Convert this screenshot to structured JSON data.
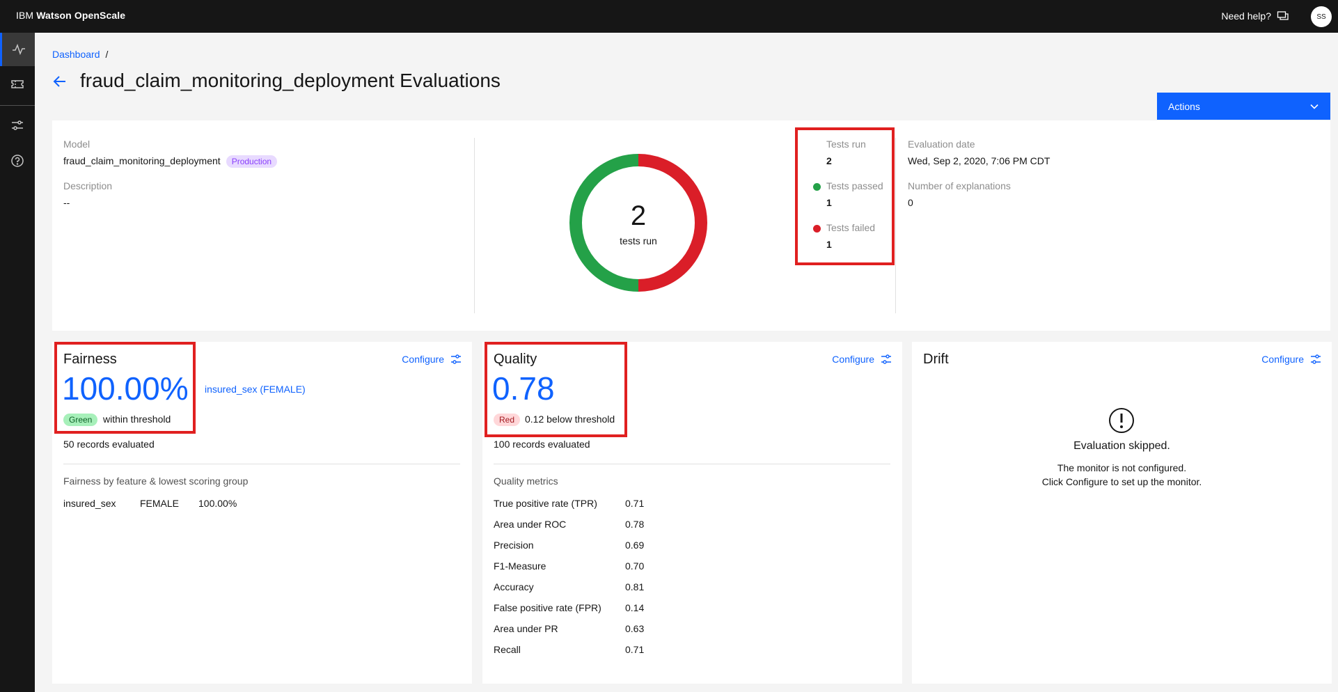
{
  "topbar": {
    "brand_prefix": "IBM",
    "brand_name": "Watson OpenScale",
    "help_label": "Need help?",
    "avatar_initials": "SS"
  },
  "rail": {
    "items": [
      "activity-icon",
      "ticket-icon",
      "sliders-icon",
      "help-icon"
    ]
  },
  "breadcrumb": {
    "root": "Dashboard",
    "separator": "/"
  },
  "page": {
    "title": "fraud_claim_monitoring_deployment Evaluations"
  },
  "actions": {
    "label": "Actions"
  },
  "summary": {
    "model_label": "Model",
    "model_value": "fraud_claim_monitoring_deployment",
    "model_badge": "Production",
    "description_label": "Description",
    "description_value": "--",
    "donut_value": "2",
    "donut_caption": "tests run",
    "tests_run_label": "Tests run",
    "tests_run_value": "2",
    "tests_passed_label": "Tests passed",
    "tests_passed_value": "1",
    "tests_failed_label": "Tests failed",
    "tests_failed_value": "1",
    "eval_date_label": "Evaluation date",
    "eval_date_value": "Wed, Sep 2, 2020, 7:06 PM CDT",
    "explanations_label": "Number of explanations",
    "explanations_value": "0"
  },
  "colors": {
    "pass": "#24a148",
    "fail": "#da1e28",
    "accent": "#0f62fe"
  },
  "fairness": {
    "title": "Fairness",
    "configure": "Configure",
    "score": "100.00%",
    "group_link": "insured_sex (FEMALE)",
    "status_tag": "Green",
    "status_text": "within threshold",
    "records": "50 records evaluated",
    "section_title": "Fairness by feature & lowest scoring group",
    "row": {
      "feature": "insured_sex",
      "group": "FEMALE",
      "value": "100.00%"
    }
  },
  "quality": {
    "title": "Quality",
    "configure": "Configure",
    "score": "0.78",
    "status_tag": "Red",
    "status_text": "0.12 below threshold",
    "records": "100 records evaluated",
    "section_title": "Quality metrics",
    "metrics": [
      {
        "name": "True positive rate (TPR)",
        "value": "0.71"
      },
      {
        "name": "Area under ROC",
        "value": "0.78"
      },
      {
        "name": "Precision",
        "value": "0.69"
      },
      {
        "name": "F1-Measure",
        "value": "0.70"
      },
      {
        "name": "Accuracy",
        "value": "0.81"
      },
      {
        "name": "False positive rate (FPR)",
        "value": "0.14"
      },
      {
        "name": "Area under PR",
        "value": "0.63"
      },
      {
        "name": "Recall",
        "value": "0.71"
      }
    ]
  },
  "drift": {
    "title": "Drift",
    "configure": "Configure",
    "skipped_title": "Evaluation skipped.",
    "skipped_line1": "The monitor is not configured.",
    "skipped_line2": "Click Configure to set up the monitor."
  }
}
